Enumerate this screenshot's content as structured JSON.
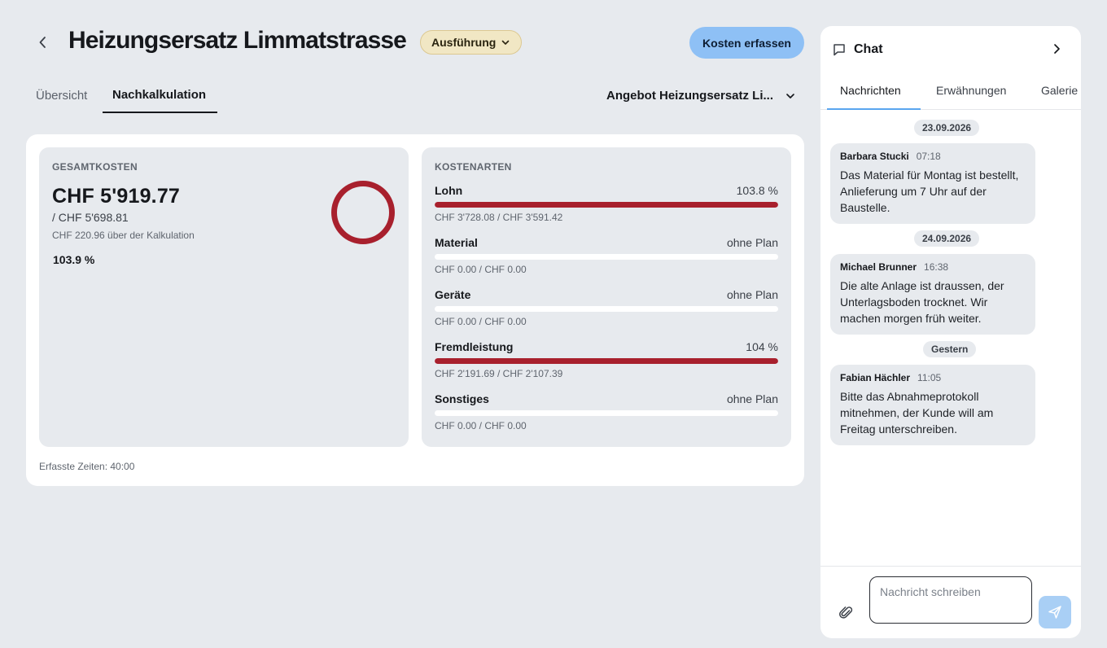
{
  "header": {
    "title": "Heizungsersatz Limmatstrasse",
    "status": "Ausführung",
    "primary_action": "Kosten erfassen"
  },
  "tabs": [
    {
      "label": "Übersicht",
      "active": false
    },
    {
      "label": "Nachkalkulation",
      "active": true
    }
  ],
  "offer_select": {
    "value": "Angebot Heizungsersatz Li..."
  },
  "total": {
    "label": "GESAMTKOSTEN",
    "amount": "CHF 5'919.77",
    "plan": "/ CHF 5'698.81",
    "over_text": "CHF 220.96 über der Kalkulation",
    "percent": "103.9 %",
    "ring_color": "#a8202d"
  },
  "cost_types": {
    "label": "KOSTENARTEN",
    "items": [
      {
        "name": "Lohn",
        "percent": "103.8 %",
        "fill": 1.0,
        "amounts": "CHF 3'728.08 / CHF 3'591.42"
      },
      {
        "name": "Material",
        "percent": "ohne Plan",
        "fill": 0,
        "amounts": "CHF 0.00 / CHF 0.00"
      },
      {
        "name": "Geräte",
        "percent": "ohne Plan",
        "fill": 0,
        "amounts": "CHF 0.00 / CHF 0.00"
      },
      {
        "name": "Fremdleistung",
        "percent": "104 %",
        "fill": 1.0,
        "amounts": "CHF 2'191.69 / CHF 2'107.39"
      },
      {
        "name": "Sonstiges",
        "percent": "ohne Plan",
        "fill": 0,
        "amounts": "CHF 0.00 / CHF 0.00"
      }
    ]
  },
  "captured_times": "Erfasste Zeiten: 40:00",
  "chat": {
    "title": "Chat",
    "tabs": [
      {
        "label": "Nachrichten",
        "active": true
      },
      {
        "label": "Erwähnungen",
        "active": false
      },
      {
        "label": "Galerie",
        "active": false
      }
    ],
    "dates": [
      "23.09.2026",
      "24.09.2026",
      "Gestern"
    ],
    "messages": [
      {
        "author": "Barbara Stucki",
        "time": "07:18",
        "text": "Das Material für Montag ist bestellt, Anlieferung um 7 Uhr auf der Baustelle."
      },
      {
        "author": "Michael Brunner",
        "time": "16:38",
        "text": "Die alte Anlage ist draussen, der Unterlagsboden trocknet. Wir machen morgen früh weiter."
      },
      {
        "author": "Fabian Hächler",
        "time": "11:05",
        "text": "Bitte das Abnahmeprotokoll mitnehmen, der Kunde will am Freitag unterschreiben."
      }
    ],
    "input_placeholder": "Nachricht schreiben"
  },
  "colors": {
    "accent": "#8ec0f5",
    "over_budget": "#a8202d",
    "status_badge": "#f1e7c4"
  }
}
